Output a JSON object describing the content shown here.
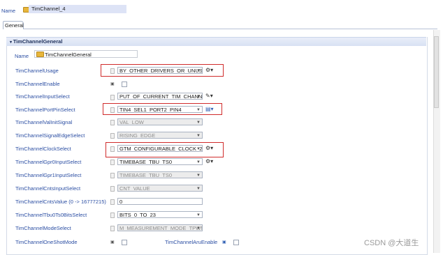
{
  "header": {
    "name_label": "Name",
    "name_value": "TimChannel_4"
  },
  "tabs": [
    {
      "label": "General"
    }
  ],
  "section": {
    "title": "TimChannelGeneral",
    "name_label": "Name",
    "name_value": "TimChannelGeneral"
  },
  "rows": [
    {
      "label": "TimChannelUsage",
      "kind": "combo",
      "value": "BY_OTHER_DRIVERS_OR_UNUSED",
      "disabled": false,
      "action": "⚙▾"
    },
    {
      "label": "TimChannelEnable",
      "kind": "checkbox",
      "checked": false
    },
    {
      "label": "TimChannelInputSelect",
      "kind": "combo",
      "value": "PUT_OF_CURRENT_TIM_CHANNEL",
      "disabled": false,
      "action": "✎▾"
    },
    {
      "label": "TimChannelPortPinSelect",
      "kind": "combo",
      "value": "TIN4_SEL1_PORT2_PIN4",
      "disabled": false,
      "action": "▤▾"
    },
    {
      "label": "TimChannelValInitSignal",
      "kind": "combo",
      "value": "VAL_LOW",
      "disabled": true
    },
    {
      "label": "TimChannelSignalEdgeSelect",
      "kind": "combo",
      "value": "RISING_EDGE",
      "disabled": true
    },
    {
      "label": "TimChannelClockSelect",
      "kind": "combo",
      "value": "GTM_CONFIGURABLE_CLOCK_2",
      "disabled": false,
      "action": "⚙▾"
    },
    {
      "label": "TimChannelGpr0InputSelect",
      "kind": "combo",
      "value": "TIMEBASE_TBU_TS0",
      "disabled": false,
      "action": "⚙▾"
    },
    {
      "label": "TimChannelGpr1InputSelect",
      "kind": "combo",
      "value": "TIMEBASE_TBU_TS0",
      "disabled": true
    },
    {
      "label": "TimChannelCntsInputSelect",
      "kind": "combo",
      "value": "CNT_VALUE",
      "disabled": true
    },
    {
      "label": "TimChannelCntsValue (0 -> 16777215)",
      "kind": "input",
      "value": "0"
    },
    {
      "label": "TimChannelTbu0Ts0BitsSelect",
      "kind": "combo",
      "value": "BITS_0_TO_23",
      "disabled": false
    },
    {
      "label": "TimChannelModeSelect",
      "kind": "combo",
      "value": "M_MEASUREMENT_MODE_TPWM",
      "disabled": true
    },
    {
      "label": "TimChannelOneShotMode",
      "kind": "checkbox",
      "checked": false
    }
  ],
  "extra": {
    "aru_label": "TimChannelAruEnable"
  },
  "watermark": "CSDN @大道生"
}
